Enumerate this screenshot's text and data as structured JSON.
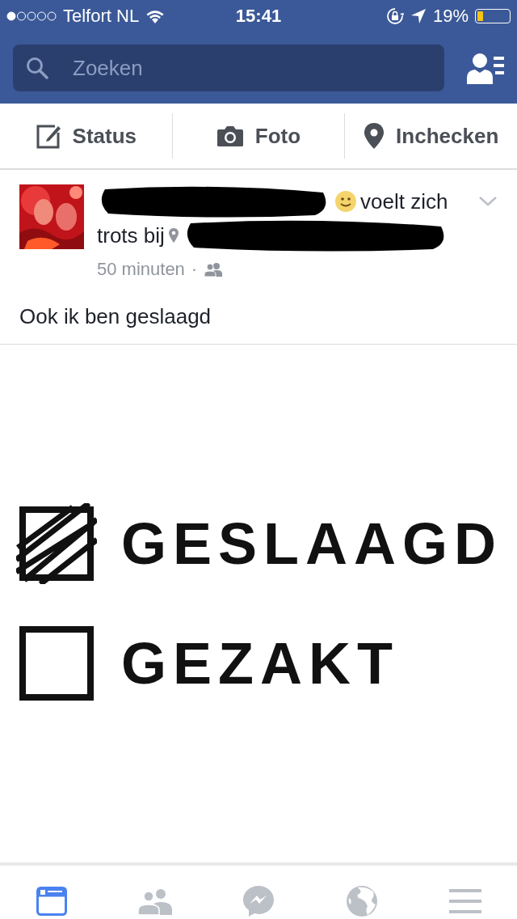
{
  "status_bar": {
    "carrier": "Telfort NL",
    "time": "15:41",
    "battery": "19%"
  },
  "search": {
    "placeholder": "Zoeken"
  },
  "composer": [
    {
      "kind": "status",
      "label": "Status"
    },
    {
      "label": "Foto"
    },
    {
      "kind": "checkin",
      "label": "Inchecken"
    }
  ],
  "post": {
    "feeling": "voelt zich",
    "feeling_rest": "trots bij",
    "time": "50 minuten",
    "separator": "·",
    "text": "Ook ik ben geslaagd",
    "image_items": [
      {
        "label": "GESLAAGD",
        "checked": true
      },
      {
        "label": "GEZAKT",
        "checked": false
      }
    ]
  },
  "tab_bar": [
    {
      "kind": "feed",
      "selected": true
    },
    {
      "kind": "friends",
      "selected": false
    },
    {
      "kind": "messenger",
      "selected": false
    },
    {
      "kind": "globe",
      "selected": false
    },
    {
      "kind": "menu",
      "selected": false
    }
  ]
}
